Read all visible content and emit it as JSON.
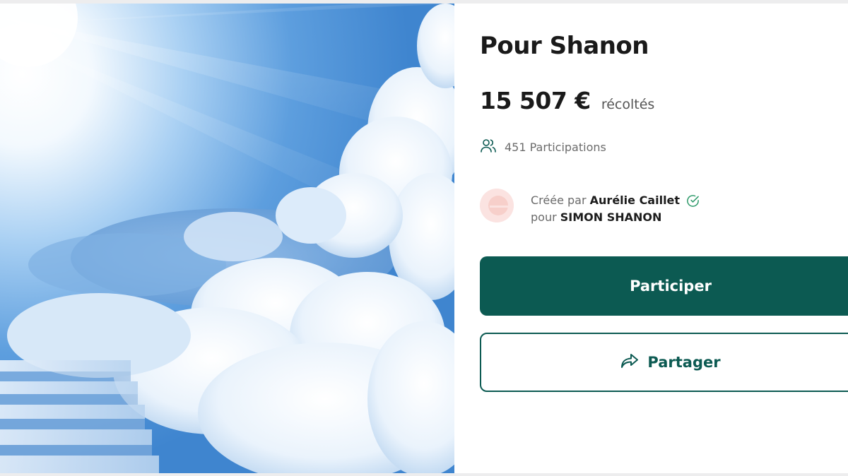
{
  "campaign": {
    "title": "Pour Shanon",
    "amount": "15 507 €",
    "amount_suffix": "récoltés",
    "participations": "451 Participations"
  },
  "creator": {
    "created_by_prefix": "Créée par",
    "name": "Aurélie Caillet",
    "for_prefix": "pour",
    "beneficiary": "SIMON SHANON"
  },
  "actions": {
    "participate_label": "Participer",
    "share_label": "Partager"
  },
  "icons": {
    "participants": "users-icon",
    "verified": "check-circle-icon",
    "share": "share-arrow-icon"
  },
  "colors": {
    "primary": "#0c5a52",
    "avatar_bg": "#fbe3e1",
    "sky": "#5e9fdc"
  }
}
